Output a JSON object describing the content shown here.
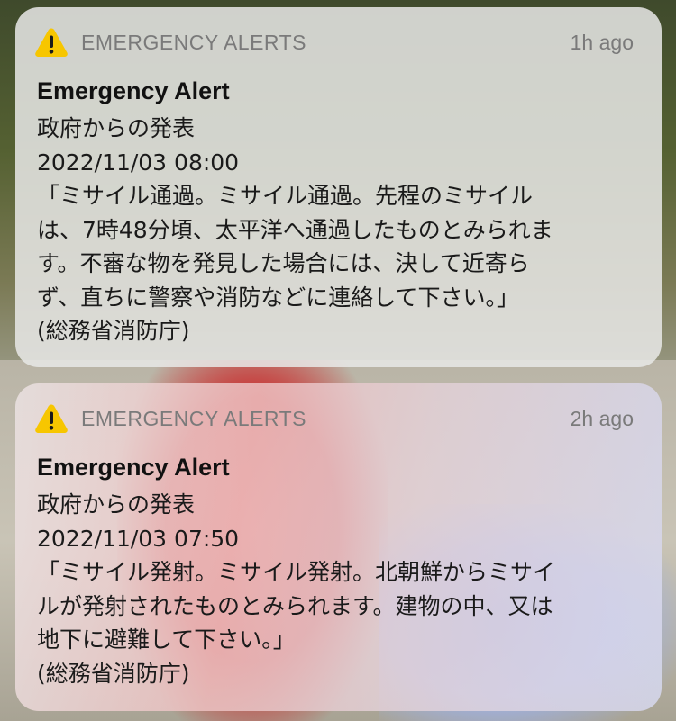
{
  "notifications": [
    {
      "app_name": "EMERGENCY ALERTS",
      "time": "1h ago",
      "title": "Emergency Alert",
      "lines": [
        "政府からの発表",
        "2022/11/03 08:00",
        "「ミサイル通過。ミサイル通過。先程のミサイル",
        "は、7時48分頃、太平洋へ通過したものとみられま",
        "す。不審な物を発見した場合には、決して近寄ら",
        "ず、直ちに警察や消防などに連絡して下さい。」",
        "(総務省消防庁)"
      ],
      "icon": "warning-triangle-icon"
    },
    {
      "app_name": "EMERGENCY ALERTS",
      "time": "2h ago",
      "title": "Emergency Alert",
      "lines": [
        "政府からの発表",
        "2022/11/03 07:50",
        "「ミサイル発射。ミサイル発射。北朝鮮からミサイ",
        "ルが発射されたものとみられます。建物の中、又は",
        "地下に避難して下さい。」",
        "(総務省消防庁)"
      ],
      "icon": "warning-triangle-icon"
    }
  ],
  "colors": {
    "warning_yellow": "#f7c600",
    "card_background": "#e8e8e6",
    "secondary_text": "#7a7a7a",
    "primary_text": "#111111"
  }
}
